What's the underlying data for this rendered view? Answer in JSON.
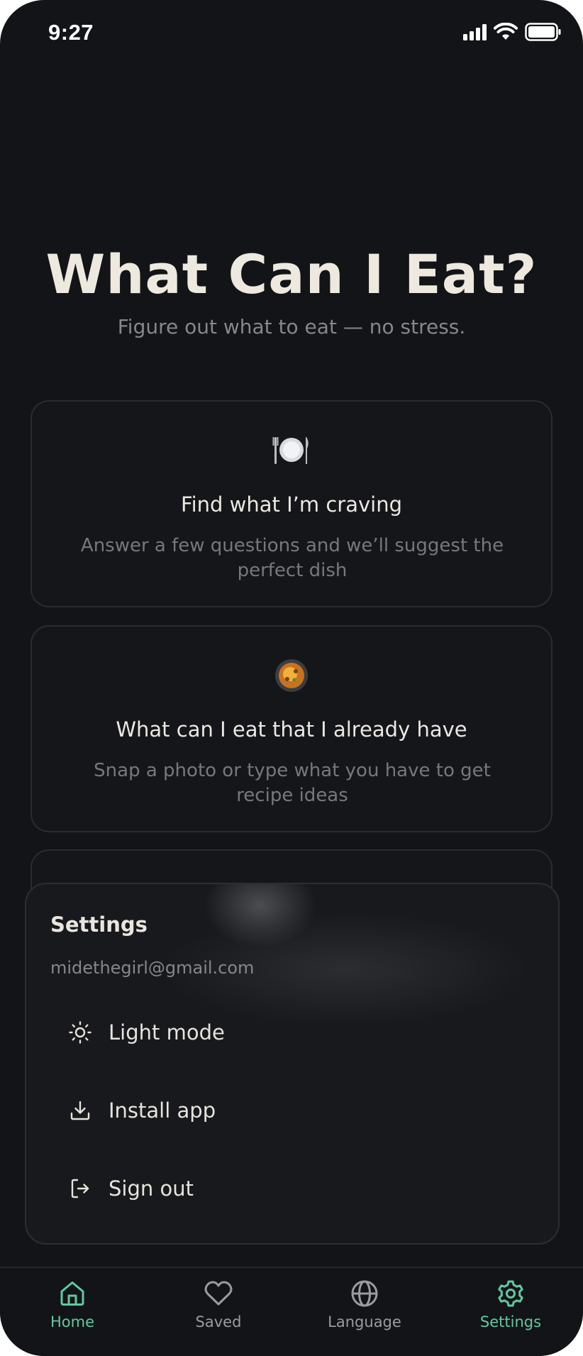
{
  "status_bar": {
    "time": "9:27"
  },
  "hero": {
    "title": "What Can I Eat?",
    "subtitle": "Figure out what to eat — no stress."
  },
  "cards": [
    {
      "icon": "plate-with-cutlery-icon",
      "title": "Find what I’m craving",
      "description": "Answer a few questions and we’ll suggest the perfect dish"
    },
    {
      "icon": "paella-pan-icon",
      "title": "What can I eat that I already have",
      "description": "Snap a photo or type what you have to get recipe ideas"
    }
  ],
  "settings": {
    "title": "Settings",
    "email": "midethegirl@gmail.com",
    "items": [
      {
        "icon": "sun-icon",
        "label": "Light mode"
      },
      {
        "icon": "download-icon",
        "label": "Install app"
      },
      {
        "icon": "sign-out-icon",
        "label": "Sign out"
      }
    ]
  },
  "tabs": [
    {
      "icon": "home-icon",
      "label": "Home",
      "active": true
    },
    {
      "icon": "heart-icon",
      "label": "Saved",
      "active": false
    },
    {
      "icon": "globe-icon",
      "label": "Language",
      "active": false
    },
    {
      "icon": "gear-icon",
      "label": "Settings",
      "active": true
    }
  ],
  "colors": {
    "background": "#131417",
    "accent": "#5fc9a0",
    "muted": "#85878c",
    "text": "#ece8df"
  }
}
